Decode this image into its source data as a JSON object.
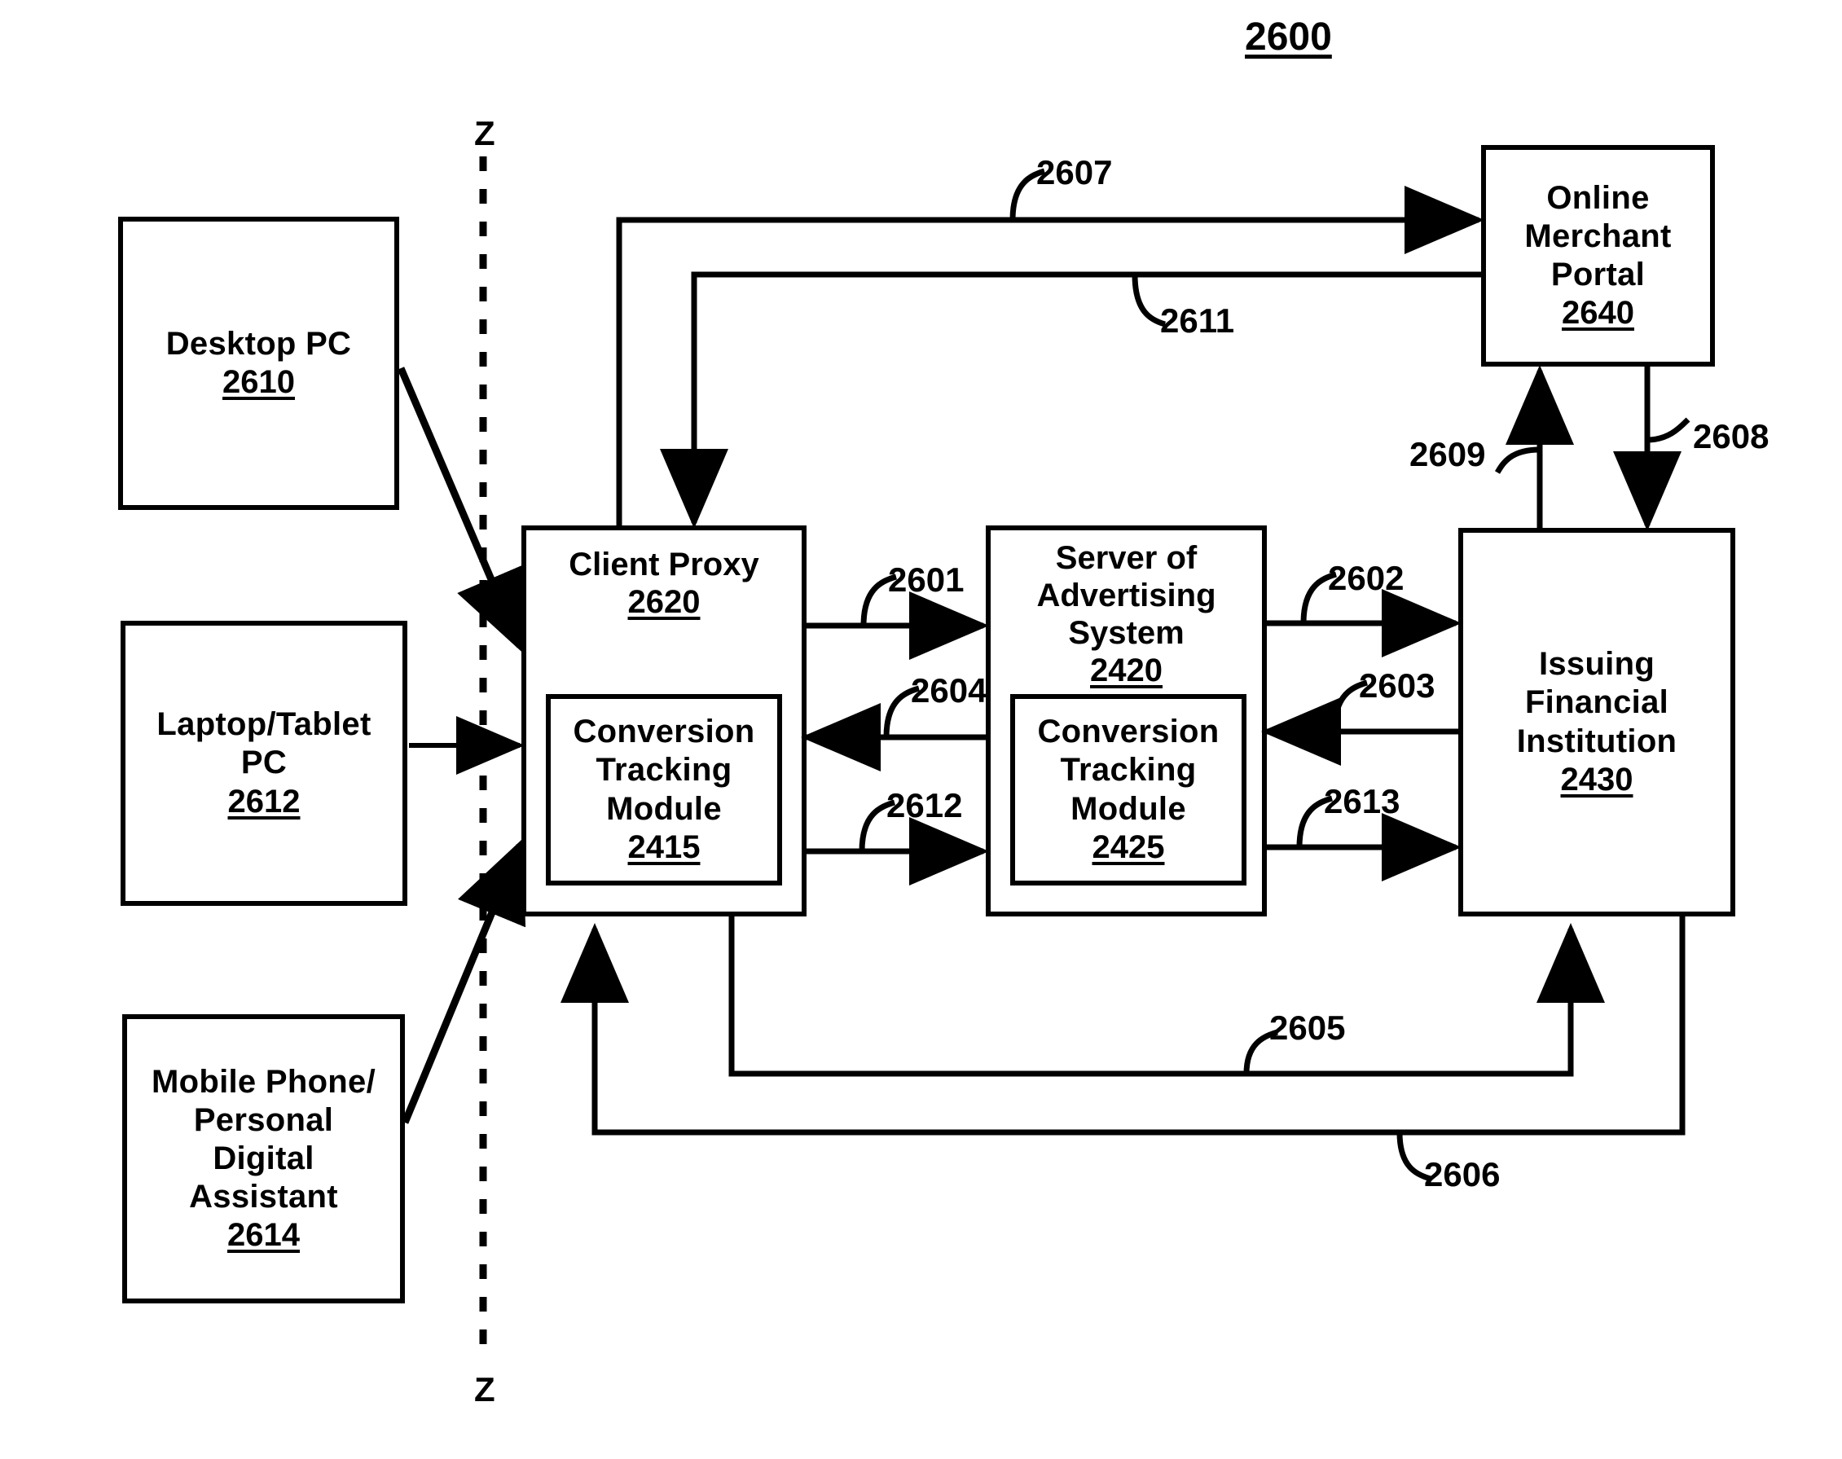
{
  "figure": {
    "number": "2600"
  },
  "section_markers": {
    "top": "Z",
    "bottom": "Z"
  },
  "nodes": {
    "desktop_pc": {
      "title": "Desktop PC",
      "ref": "2610"
    },
    "laptop_tablet_pc": {
      "title_line1": "Laptop/Tablet",
      "title_line2": "PC",
      "ref": "2612"
    },
    "mobile_pda": {
      "title_line1": "Mobile Phone/",
      "title_line2": "Personal",
      "title_line3": "Digital",
      "title_line4": "Assistant",
      "ref": "2614"
    },
    "client_proxy": {
      "title": "Client Proxy",
      "ref": "2620"
    },
    "client_conversion_tracking_module": {
      "title_line1": "Conversion",
      "title_line2": "Tracking",
      "title_line3": "Module",
      "ref": "2415"
    },
    "server_advertising_system": {
      "title_line1": "Server of",
      "title_line2": "Advertising",
      "title_line3": "System",
      "ref": "2420"
    },
    "server_conversion_tracking_module": {
      "title_line1": "Conversion",
      "title_line2": "Tracking",
      "title_line3": "Module",
      "ref": "2425"
    },
    "issuing_financial_institution": {
      "title_line1": "Issuing",
      "title_line2": "Financial",
      "title_line3": "Institution",
      "ref": "2430"
    },
    "online_merchant_portal": {
      "title_line1": "Online",
      "title_line2": "Merchant",
      "title_line3": "Portal",
      "ref": "2640"
    }
  },
  "flow_labels": {
    "l2601": "2601",
    "l2602": "2602",
    "l2603": "2603",
    "l2604": "2604",
    "l2605": "2605",
    "l2606": "2606",
    "l2607": "2607",
    "l2608": "2608",
    "l2609": "2609",
    "l2611": "2611",
    "l2612": "2612",
    "l2613": "2613"
  },
  "colors": {
    "stroke": "#000000",
    "background": "#ffffff"
  }
}
